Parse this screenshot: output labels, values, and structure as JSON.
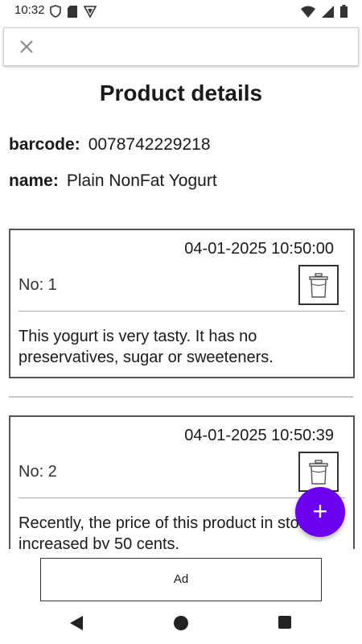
{
  "status": {
    "time": "10:32"
  },
  "search": {
    "value": "",
    "placeholder": ""
  },
  "page": {
    "title": "Product details"
  },
  "product": {
    "barcode_label": "barcode:",
    "barcode": "0078742229218",
    "name_label": "name:",
    "name": "Plain NonFat Yogurt"
  },
  "reviews": [
    {
      "date": "04-01-2025 10:50:00",
      "no": "No: 1",
      "text": "This yogurt is very tasty. It has no preservatives, sugar or sweeteners."
    },
    {
      "date": "04-01-2025 10:50:39",
      "no": "No: 2",
      "text": "Recently, the price of this product in store increased by 50 cents."
    }
  ],
  "fab": {
    "label": "+"
  },
  "ad": {
    "label": "Ad"
  },
  "colors": {
    "accent": "#6a00ee",
    "border": "#555555"
  }
}
